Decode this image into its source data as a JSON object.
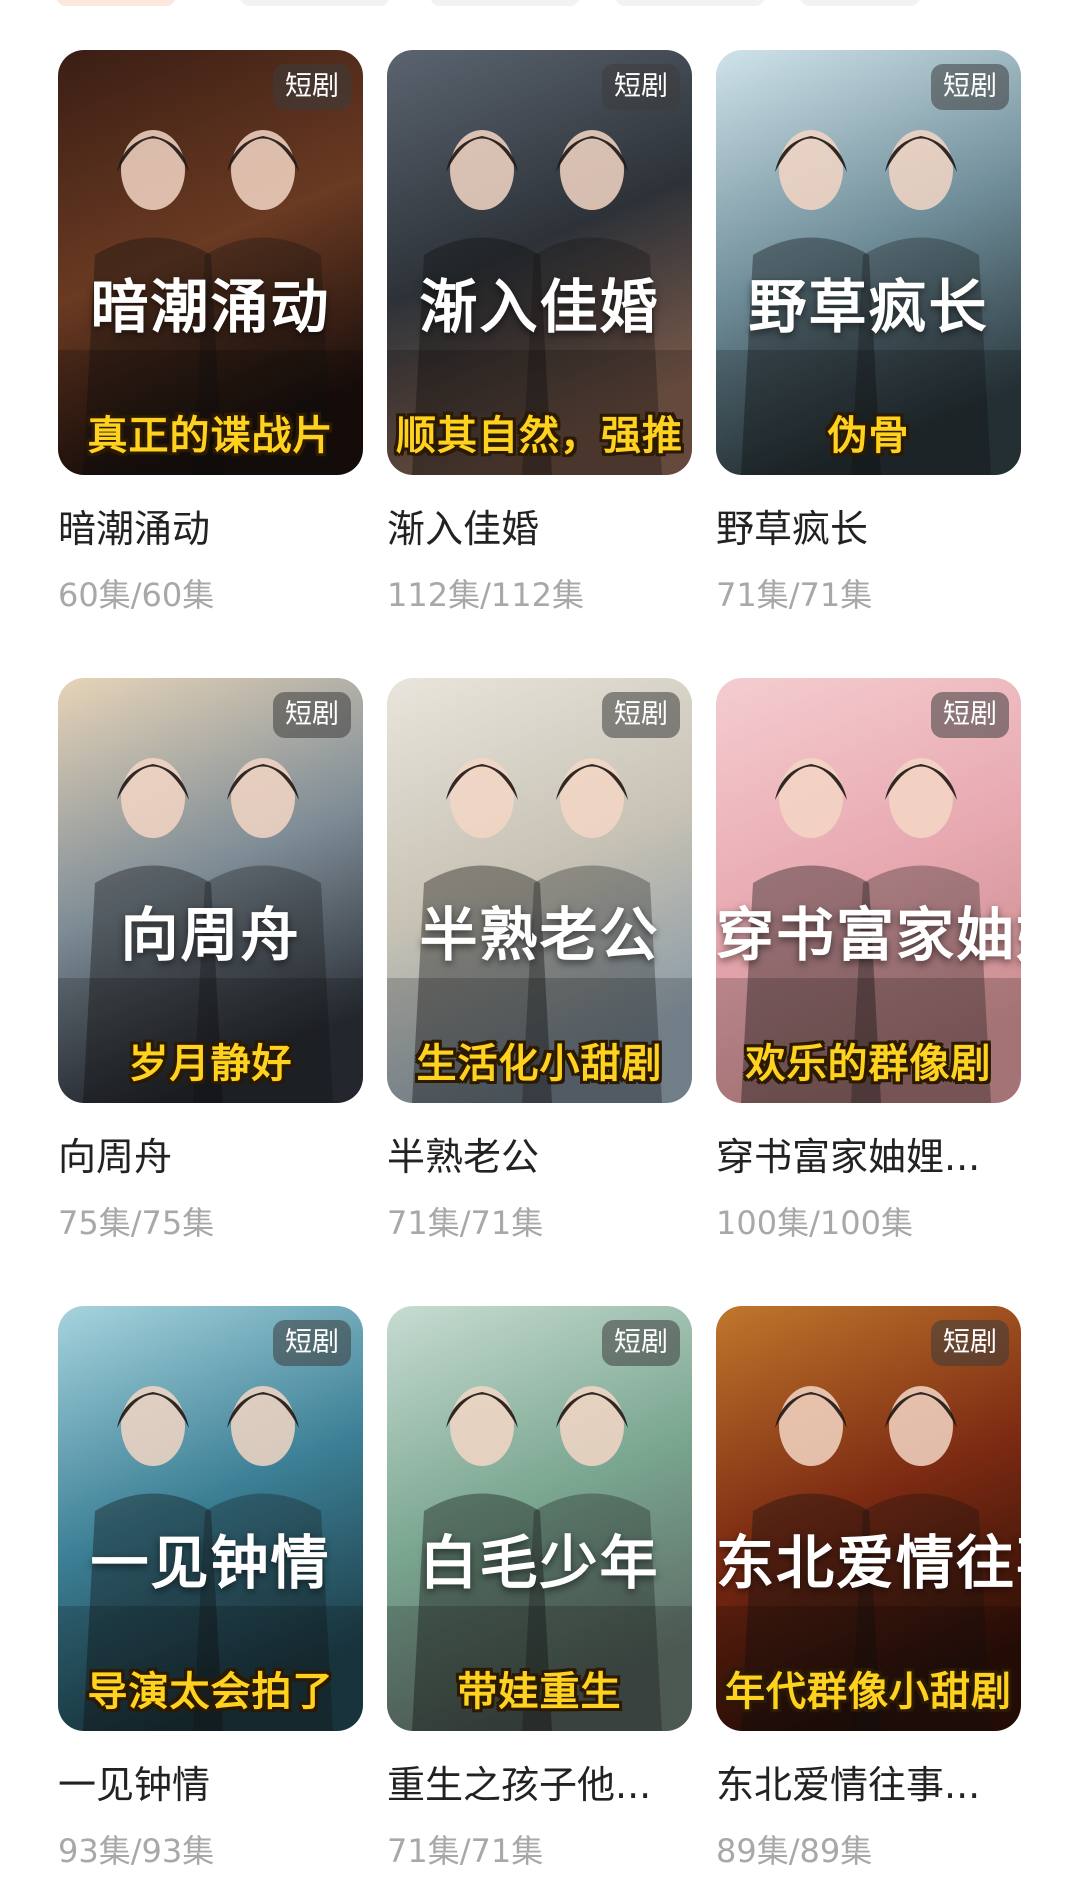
{
  "badge_label": "短剧",
  "dramas": [
    {
      "name": "暗潮涌动",
      "episodes": "60集/60集",
      "poster_title": "暗潮涌动",
      "tag": "真正的谍战片",
      "colors": [
        "#3a1e14",
        "#6a3a22",
        "#1a0f0c"
      ]
    },
    {
      "name": "渐入佳婚",
      "episodes": "112集/112集",
      "poster_title": "渐入佳婚",
      "tag": "顺其自然，强推",
      "colors": [
        "#5b6470",
        "#2d3238",
        "#7c5a4a"
      ]
    },
    {
      "name": "野草疯长",
      "episodes": "71集/71集",
      "poster_title": "野草疯长",
      "tag": "伪骨",
      "colors": [
        "#cfe3ea",
        "#6f8d99",
        "#2c3a40"
      ]
    },
    {
      "name": "向周舟",
      "episodes": "75集/75集",
      "poster_title": "向周舟",
      "tag": "岁月静好",
      "colors": [
        "#e7d4b8",
        "#7e8c96",
        "#2b3038"
      ]
    },
    {
      "name": "半熟老公",
      "episodes": "71集/71集",
      "poster_title": "半熟老公",
      "tag": "生活化小甜剧",
      "colors": [
        "#e9e5dc",
        "#c7c2b4",
        "#8a9aa6"
      ]
    },
    {
      "name": "穿书富家妯娌...",
      "episodes": "100集/100集",
      "poster_title": "穿书富家妯娌",
      "tag": "欢乐的群像剧",
      "colors": [
        "#f4cdd0",
        "#e8a9b1",
        "#c98d8f"
      ]
    },
    {
      "name": "一见钟情",
      "episodes": "93集/93集",
      "poster_title": "一见钟情",
      "tag": "导演太会拍了",
      "colors": [
        "#a6d4de",
        "#3c7f95",
        "#1e3f4a"
      ]
    },
    {
      "name": "重生之孩子他...",
      "episodes": "71集/71集",
      "poster_title": "白毛少年",
      "tag": "带娃重生",
      "colors": [
        "#c7dcd2",
        "#7aa690",
        "#5d6d66"
      ]
    },
    {
      "name": "东北爱情往事...",
      "episodes": "89集/89集",
      "poster_title": "东北爱情往事",
      "tag": "年代群像小甜剧",
      "colors": [
        "#c0772c",
        "#7c2a12",
        "#2d0f08"
      ]
    }
  ]
}
